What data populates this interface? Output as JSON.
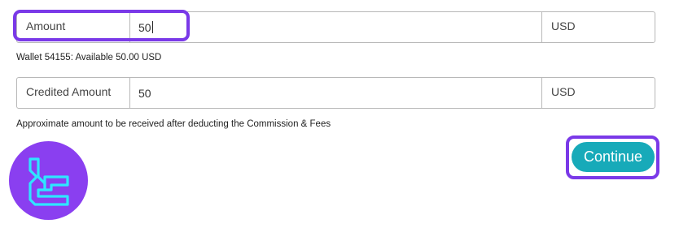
{
  "form": {
    "amount": {
      "label": "Amount",
      "value": "50",
      "currency": "USD"
    },
    "wallet_info": "Wallet 54155: Available 50.00 USD",
    "credited": {
      "label": "Credited Amount",
      "value": "50",
      "currency": "USD"
    },
    "approx_note": "Approximate amount to be received after deducting the Commission & Fees"
  },
  "actions": {
    "continue_label": "Continue"
  },
  "logo": {
    "icon": "brand-logo-icon"
  },
  "colors": {
    "highlight": "#7a39e8",
    "button": "#17aab9",
    "logo_bg": "#8a3ff0",
    "logo_stroke": "#2ee6ff"
  }
}
